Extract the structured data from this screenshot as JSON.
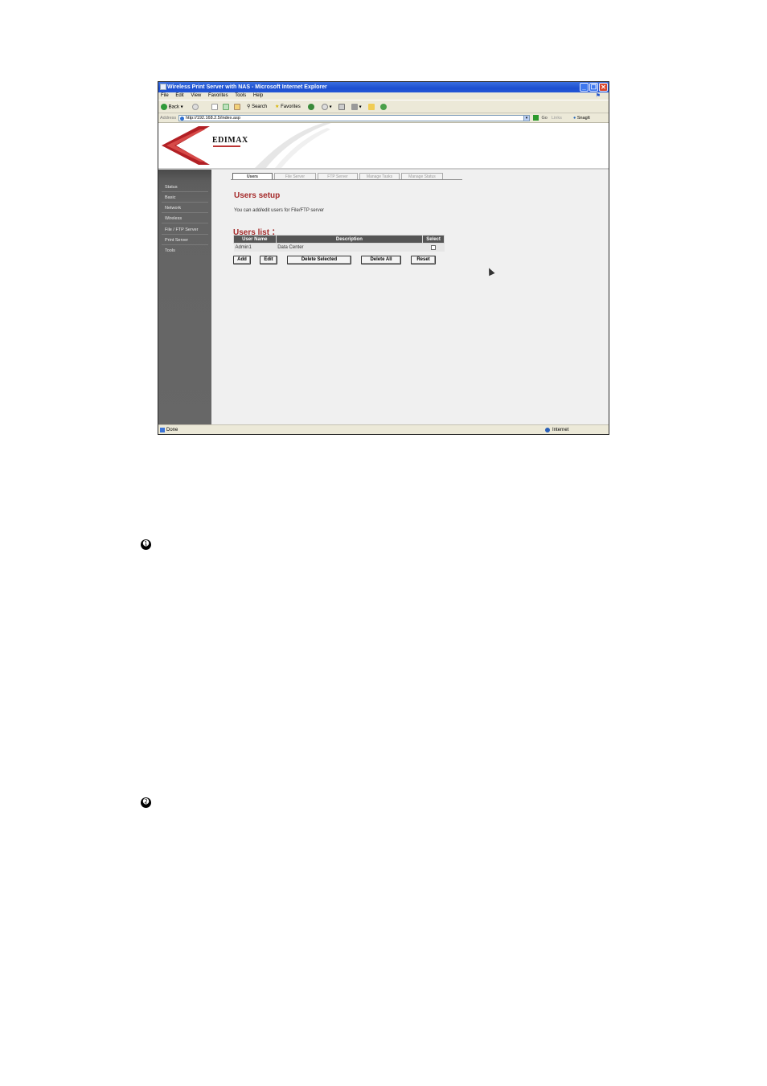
{
  "window": {
    "title": "Wireless Print Server with NAS - Microsoft Internet Explorer",
    "controls": [
      "_",
      "❐",
      "✕"
    ]
  },
  "menu": [
    "File",
    "Edit",
    "View",
    "Favorites",
    "Tools",
    "Help"
  ],
  "toolbar": {
    "back": "Back",
    "search": "Search",
    "favorites": "Favorites"
  },
  "address": {
    "label": "Address",
    "url": "http://192.168.2.5/index.asp",
    "go": "Go",
    "links": "Links",
    "snagit": "SnagIt"
  },
  "brand": {
    "logo": "EDIMAX"
  },
  "sidebar": {
    "items": [
      {
        "label": "Status"
      },
      {
        "label": "Basic"
      },
      {
        "label": "Network"
      },
      {
        "label": "Wireless"
      },
      {
        "label": "File / FTP Server"
      },
      {
        "label": "Print Server"
      },
      {
        "label": "Tools"
      }
    ]
  },
  "tabs": [
    {
      "label": "Users",
      "active": true
    },
    {
      "label": "File Server"
    },
    {
      "label": "FTP Server"
    },
    {
      "label": "Manage Tasks"
    },
    {
      "label": "Manage Status"
    }
  ],
  "main": {
    "heading": "Users setup",
    "description": "You can add/edit users for File/FTP server",
    "list_heading": "Users list ："
  },
  "table": {
    "columns": [
      "User Name",
      "Description",
      "Select"
    ],
    "rows": [
      {
        "user": "Admin1",
        "description": "Data Center",
        "selected": false
      }
    ]
  },
  "buttons": {
    "add": "Add",
    "edit": "Edit",
    "delete_selected": "Delete Selected",
    "delete_all": "Delete All",
    "reset": "Reset"
  },
  "status": {
    "left": "Done",
    "zone": "Internet"
  },
  "bullets": [
    "➊",
    "➋"
  ]
}
